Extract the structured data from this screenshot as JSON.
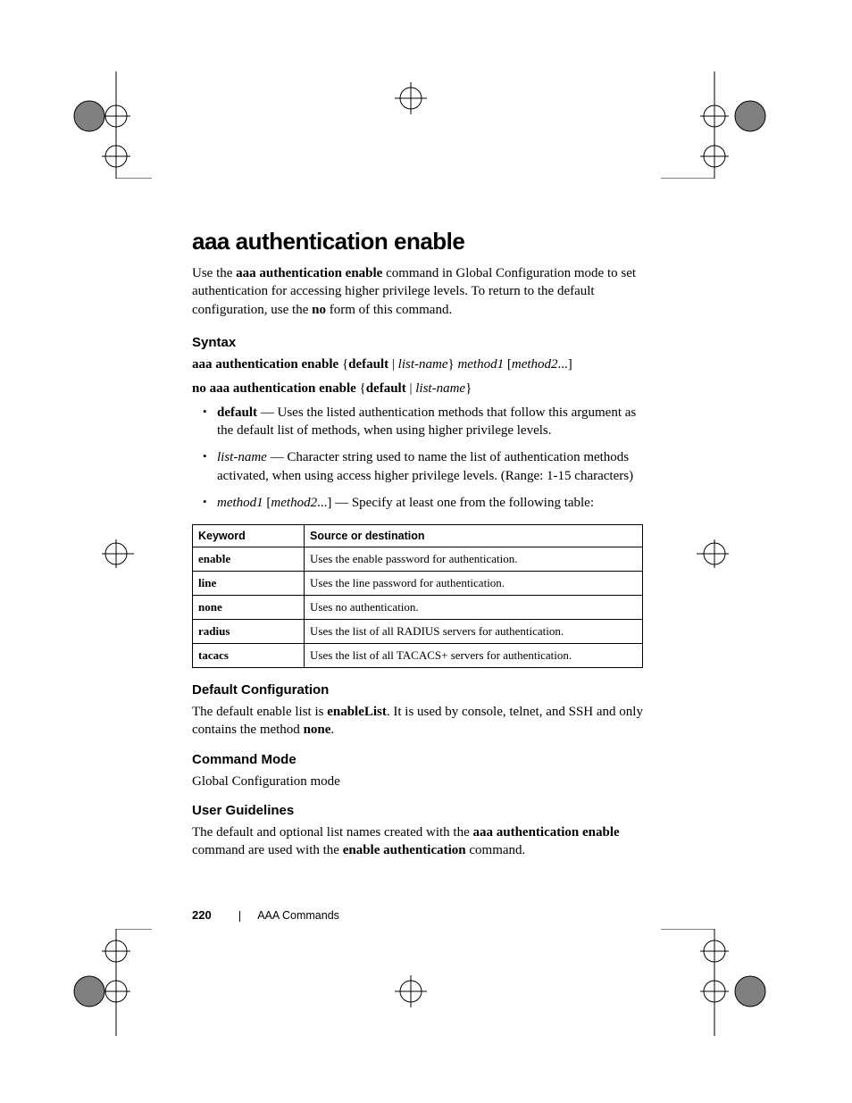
{
  "title": "aaa authentication enable",
  "intro_parts": {
    "p1": "Use the ",
    "b1": "aaa authentication enable",
    "p2": " command in Global Configuration mode to set authentication for accessing higher privilege levels. To return to the default configuration, use the ",
    "b2": "no",
    "p3": " form of this command."
  },
  "syntax": {
    "heading": "Syntax",
    "line1": {
      "b1": "aaa authentication enable",
      "t1": " {",
      "b2": "default",
      "t2": " | ",
      "i1": "list-name",
      "t3": "} ",
      "i2": "method1",
      "t4": " [",
      "i3": "method2",
      "t5": "...]"
    },
    "line2": {
      "b1": "no aaa authentication enable",
      "t1": " {",
      "b2": "default",
      "t2": " | ",
      "i1": "list-name",
      "t3": "}"
    },
    "bullets": {
      "b0": {
        "b": "default",
        "rest": " — Uses the listed authentication methods that follow this argument as the default list of methods, when using higher privilege levels."
      },
      "b1": {
        "i": "list-name",
        "rest": " — Character string used to name the list of authentication methods activated, when using access higher privilege levels. (Range: 1-15 characters)"
      },
      "b2": {
        "i1": "method1",
        "t1": " [",
        "i2": "method2",
        "t2": "...] — Specify at least one from the following table:"
      }
    }
  },
  "table": {
    "headers": {
      "kw": "Keyword",
      "desc": "Source or destination"
    },
    "rows": [
      {
        "kw": "enable",
        "desc": "Uses the enable password for authentication."
      },
      {
        "kw": "line",
        "desc": "Uses the line password for authentication."
      },
      {
        "kw": "none",
        "desc": "Uses no authentication."
      },
      {
        "kw": "radius",
        "desc": "Uses the list of all RADIUS servers for authentication."
      },
      {
        "kw": "tacacs",
        "desc": "Uses the list of all TACACS+ servers for authentication."
      }
    ]
  },
  "default_config": {
    "heading": "Default Configuration",
    "p": {
      "t1": "The default enable list is ",
      "b1": "enableList",
      "t2": ". It is used by console, telnet, and SSH and only contains the method ",
      "b2": "none",
      "t3": "."
    }
  },
  "command_mode": {
    "heading": "Command Mode",
    "body": "Global Configuration mode"
  },
  "user_guidelines": {
    "heading": "User Guidelines",
    "p": {
      "t1": "The default and optional list names created with the ",
      "b1": "aaa authentication enable",
      "t2": " command are used with the ",
      "b2": "enable authentication",
      "t3": " command."
    }
  },
  "footer": {
    "page": "220",
    "section": "AAA Commands"
  }
}
